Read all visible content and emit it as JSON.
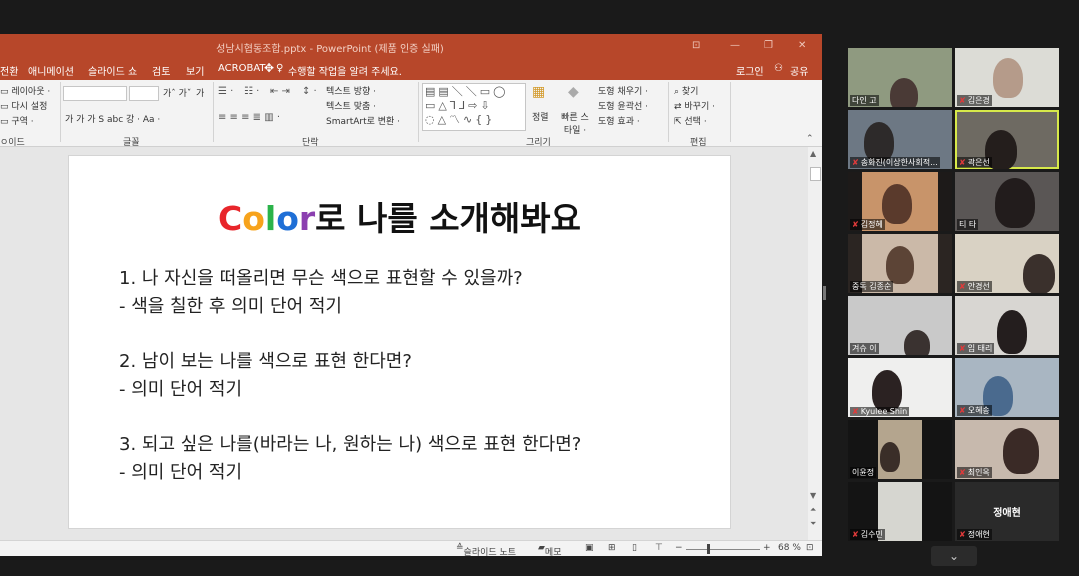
{
  "window": {
    "title": "성남시협동조합.pptx - PowerPoint (제품 인증 실패)",
    "controls": {
      "ribbon_opt": "⊡",
      "minimize": "—",
      "restore": "❐",
      "close": "✕"
    }
  },
  "menu": {
    "tabs": [
      "전환",
      "애니메이션",
      "슬라이드 쇼",
      "검토",
      "보기",
      "ACROBAT"
    ],
    "tell_me": "수행할 작업을 알려 주세요.",
    "login": "로그인",
    "share": "공유"
  },
  "ribbon": {
    "slides_group": {
      "layout": "레이아웃 ·",
      "reset": "다시 설정",
      "section": "구역 ·",
      "label": "ㅇ이드"
    },
    "font_group": {
      "label": "글꼴",
      "chars": "가  가  가  S  abc  강  ·  Aa ·",
      "grow": "가ˆ  가ˇ",
      "clear": "가"
    },
    "paragraph_group": {
      "label": "단락",
      "text_direction": "텍스트 방향 ·",
      "align_text": "텍스트 맞춤 ·",
      "smartart": "SmartArt로 변환 ·"
    },
    "drawing_group": {
      "label": "그리기",
      "arrange": "정렬",
      "quick_styles": "빠른 스타일 ·",
      "fill": "도형 채우기 ·",
      "outline": "도형 윤곽선 ·",
      "effects": "도형 효과 ·"
    },
    "editing_group": {
      "label": "편집",
      "find": "찾기",
      "replace": "바꾸기 ·",
      "select": "선택 ·"
    }
  },
  "slide": {
    "title_color_letters": [
      "C",
      "o",
      "l",
      "o",
      "r"
    ],
    "title_color_hex": [
      "#e8262b",
      "#f7a31c",
      "#2bb34a",
      "#1f6fd6",
      "#8b3fb0"
    ],
    "title_rest": "로 나를 소개해봐요",
    "lines": [
      "1. 나 자신을 떠올리면 무슨 색으로 표현할 수 있을까?",
      "- 색을 칠한 후 의미 단어 적기",
      "2. 남이 보는 나를 색으로 표현 한다면?",
      "- 의미 단어 적기",
      "3. 되고 싶은 나를(바라는 나, 원하는 나) 색으로 표현 한다면?",
      "-  의미 단어 적기"
    ]
  },
  "status": {
    "notes": "슬라이드 노트",
    "comments": "메모",
    "zoom": "68 %"
  },
  "participants": [
    {
      "name": "다인 고",
      "muted": false
    },
    {
      "name": "김은경",
      "muted": true
    },
    {
      "name": "송화진(이상한사회적...",
      "muted": true
    },
    {
      "name": "곽은선",
      "muted": true
    },
    {
      "name": "김정혜",
      "muted": true
    },
    {
      "name": "티 타",
      "muted": false
    },
    {
      "name": "중독 김종순",
      "muted": false
    },
    {
      "name": "안경선",
      "muted": true
    },
    {
      "name": "겨슈 이",
      "muted": false
    },
    {
      "name": "임 태리",
      "muted": true
    },
    {
      "name": "Kyulee Shin",
      "muted": true
    },
    {
      "name": "오혜송",
      "muted": true
    },
    {
      "name": "이윤정",
      "muted": false
    },
    {
      "name": "최인옥",
      "muted": true
    },
    {
      "name": "김수민",
      "muted": true
    },
    {
      "name": "정애현",
      "muted": true
    }
  ],
  "placeholder_name": "정애현",
  "colors": {
    "ppt_brand": "#b7472a",
    "active_speaker": "#d7e94a",
    "muted_icon": "#e03a3a"
  }
}
